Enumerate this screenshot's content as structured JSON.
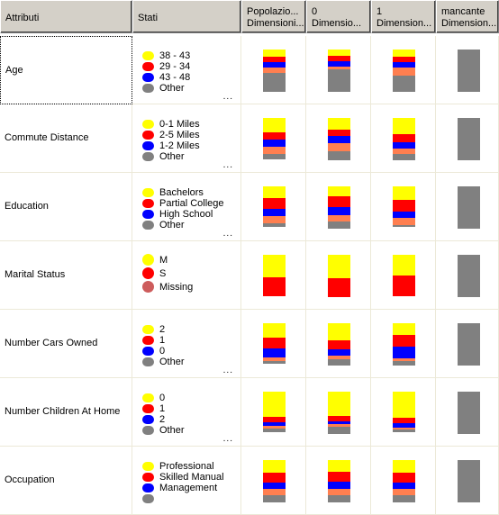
{
  "columns": {
    "attributes": "Attributi",
    "states": "Stati",
    "bars": [
      {
        "line1": "Popolazio...",
        "line2": "Dimensioni..."
      },
      {
        "line1": "0",
        "line2": "Dimensio..."
      },
      {
        "line1": "1",
        "line2": "Dimension..."
      },
      {
        "line1": "mancante",
        "line2": "Dimension..."
      }
    ]
  },
  "colors": {
    "state1": "#ffff00",
    "state2": "#ff0000",
    "state3": "#0000ff",
    "state4": "#ff7f50",
    "other": "#808080",
    "missing": "#cd5c5c"
  },
  "more_label": "...",
  "rows": [
    {
      "attribute": "Age",
      "selected": true,
      "legend": [
        {
          "label": "38 - 43",
          "color": "#ffff00"
        },
        {
          "label": "29 - 34",
          "color": "#ff0000"
        },
        {
          "label": "43 - 48",
          "color": "#0000ff"
        },
        {
          "label": "Other",
          "color": "#808080"
        }
      ],
      "more": true,
      "bars": [
        [
          {
            "c": "#ffff00",
            "v": 0.17
          },
          {
            "c": "#ff0000",
            "v": 0.13
          },
          {
            "c": "#0000ff",
            "v": 0.12
          },
          {
            "c": "#ff7f50",
            "v": 0.13
          },
          {
            "c": "#808080",
            "v": 0.45
          }
        ],
        [
          {
            "c": "#ffff00",
            "v": 0.15
          },
          {
            "c": "#ff0000",
            "v": 0.13
          },
          {
            "c": "#0000ff",
            "v": 0.13
          },
          {
            "c": "#ff7f50",
            "v": 0.06
          },
          {
            "c": "#808080",
            "v": 0.53
          }
        ],
        [
          {
            "c": "#ffff00",
            "v": 0.17
          },
          {
            "c": "#ff0000",
            "v": 0.13
          },
          {
            "c": "#0000ff",
            "v": 0.13
          },
          {
            "c": "#ff7f50",
            "v": 0.19
          },
          {
            "c": "#808080",
            "v": 0.38
          }
        ],
        [
          {
            "c": "#808080",
            "v": 1.0
          }
        ]
      ]
    },
    {
      "attribute": "Commute Distance",
      "legend": [
        {
          "label": "0-1 Miles",
          "color": "#ffff00"
        },
        {
          "label": "2-5 Miles",
          "color": "#ff0000"
        },
        {
          "label": "1-2 Miles",
          "color": "#0000ff"
        },
        {
          "label": "Other",
          "color": "#808080"
        }
      ],
      "more": true,
      "bars": [
        [
          {
            "c": "#ffff00",
            "v": 0.34
          },
          {
            "c": "#ff0000",
            "v": 0.17
          },
          {
            "c": "#0000ff",
            "v": 0.17
          },
          {
            "c": "#ff7f50",
            "v": 0.17
          },
          {
            "c": "#808080",
            "v": 0.13
          }
        ],
        [
          {
            "c": "#ffff00",
            "v": 0.28
          },
          {
            "c": "#ff0000",
            "v": 0.15
          },
          {
            "c": "#0000ff",
            "v": 0.17
          },
          {
            "c": "#ff7f50",
            "v": 0.19
          },
          {
            "c": "#808080",
            "v": 0.21
          }
        ],
        [
          {
            "c": "#ffff00",
            "v": 0.38
          },
          {
            "c": "#ff0000",
            "v": 0.19
          },
          {
            "c": "#0000ff",
            "v": 0.15
          },
          {
            "c": "#ff7f50",
            "v": 0.13
          },
          {
            "c": "#808080",
            "v": 0.15
          }
        ],
        [
          {
            "c": "#808080",
            "v": 1.0
          }
        ]
      ]
    },
    {
      "attribute": "Education",
      "legend": [
        {
          "label": "Bachelors",
          "color": "#ffff00"
        },
        {
          "label": "Partial College",
          "color": "#ff0000"
        },
        {
          "label": "High School",
          "color": "#0000ff"
        },
        {
          "label": "Other",
          "color": "#808080"
        }
      ],
      "more": true,
      "bars": [
        [
          {
            "c": "#ffff00",
            "v": 0.28
          },
          {
            "c": "#ff0000",
            "v": 0.25
          },
          {
            "c": "#0000ff",
            "v": 0.17
          },
          {
            "c": "#ff7f50",
            "v": 0.17
          },
          {
            "c": "#808080",
            "v": 0.09
          }
        ],
        [
          {
            "c": "#ffff00",
            "v": 0.23
          },
          {
            "c": "#ff0000",
            "v": 0.26
          },
          {
            "c": "#0000ff",
            "v": 0.19
          },
          {
            "c": "#ff7f50",
            "v": 0.15
          },
          {
            "c": "#808080",
            "v": 0.17
          }
        ],
        [
          {
            "c": "#ffff00",
            "v": 0.32
          },
          {
            "c": "#ff0000",
            "v": 0.28
          },
          {
            "c": "#0000ff",
            "v": 0.15
          },
          {
            "c": "#ff7f50",
            "v": 0.17
          },
          {
            "c": "#808080",
            "v": 0.04
          }
        ],
        [
          {
            "c": "#808080",
            "v": 1.0
          }
        ]
      ]
    },
    {
      "attribute": "Marital Status",
      "legend": [
        {
          "label": "M",
          "color": "#ffff00"
        },
        {
          "label": "S",
          "color": "#ff0000"
        },
        {
          "label": "Missing",
          "color": "#cd5c5c"
        }
      ],
      "more": false,
      "bars": [
        [
          {
            "c": "#ffff00",
            "v": 0.53
          },
          {
            "c": "#ff0000",
            "v": 0.45
          }
        ],
        [
          {
            "c": "#ffff00",
            "v": 0.55
          },
          {
            "c": "#ff0000",
            "v": 0.45
          }
        ],
        [
          {
            "c": "#ffff00",
            "v": 0.49
          },
          {
            "c": "#ff0000",
            "v": 0.49
          }
        ],
        [
          {
            "c": "#808080",
            "v": 1.0
          }
        ]
      ]
    },
    {
      "attribute": "Number Cars Owned",
      "legend": [
        {
          "label": "2",
          "color": "#ffff00"
        },
        {
          "label": "1",
          "color": "#ff0000"
        },
        {
          "label": "0",
          "color": "#0000ff"
        },
        {
          "label": "Other",
          "color": "#808080"
        }
      ],
      "more": true,
      "bars": [
        [
          {
            "c": "#ffff00",
            "v": 0.34
          },
          {
            "c": "#ff0000",
            "v": 0.26
          },
          {
            "c": "#0000ff",
            "v": 0.21
          },
          {
            "c": "#ff7f50",
            "v": 0.08
          },
          {
            "c": "#808080",
            "v": 0.06
          }
        ],
        [
          {
            "c": "#ffff00",
            "v": 0.4
          },
          {
            "c": "#ff0000",
            "v": 0.21
          },
          {
            "c": "#0000ff",
            "v": 0.15
          },
          {
            "c": "#ff7f50",
            "v": 0.09
          },
          {
            "c": "#808080",
            "v": 0.15
          }
        ],
        [
          {
            "c": "#ffff00",
            "v": 0.28
          },
          {
            "c": "#ff0000",
            "v": 0.28
          },
          {
            "c": "#0000ff",
            "v": 0.28
          },
          {
            "c": "#ff7f50",
            "v": 0.06
          },
          {
            "c": "#808080",
            "v": 0.11
          }
        ],
        [
          {
            "c": "#808080",
            "v": 1.0
          }
        ]
      ]
    },
    {
      "attribute": "Number Children At Home",
      "legend": [
        {
          "label": "0",
          "color": "#ffff00"
        },
        {
          "label": "1",
          "color": "#ff0000"
        },
        {
          "label": "2",
          "color": "#0000ff"
        },
        {
          "label": "Other",
          "color": "#808080"
        }
      ],
      "more": true,
      "bars": [
        [
          {
            "c": "#ffff00",
            "v": 0.6
          },
          {
            "c": "#ff0000",
            "v": 0.13
          },
          {
            "c": "#0000ff",
            "v": 0.09
          },
          {
            "c": "#ff7f50",
            "v": 0.06
          },
          {
            "c": "#808080",
            "v": 0.08
          }
        ],
        [
          {
            "c": "#ffff00",
            "v": 0.57
          },
          {
            "c": "#ff0000",
            "v": 0.13
          },
          {
            "c": "#0000ff",
            "v": 0.06
          },
          {
            "c": "#ff7f50",
            "v": 0.06
          },
          {
            "c": "#808080",
            "v": 0.17
          }
        ],
        [
          {
            "c": "#ffff00",
            "v": 0.62
          },
          {
            "c": "#ff0000",
            "v": 0.13
          },
          {
            "c": "#0000ff",
            "v": 0.11
          },
          {
            "c": "#ff7f50",
            "v": 0.04
          },
          {
            "c": "#808080",
            "v": 0.06
          }
        ],
        [
          {
            "c": "#808080",
            "v": 1.0
          }
        ]
      ]
    },
    {
      "attribute": "Occupation",
      "legend": [
        {
          "label": "Professional",
          "color": "#ffff00"
        },
        {
          "label": "Skilled Manual",
          "color": "#ff0000"
        },
        {
          "label": "Management",
          "color": "#0000ff"
        },
        {
          "label": "",
          "color": "#808080"
        }
      ],
      "more": false,
      "bars": [
        [
          {
            "c": "#ffff00",
            "v": 0.3
          },
          {
            "c": "#ff0000",
            "v": 0.23
          },
          {
            "c": "#0000ff",
            "v": 0.15
          },
          {
            "c": "#ff7f50",
            "v": 0.15
          },
          {
            "c": "#808080",
            "v": 0.17
          }
        ],
        [
          {
            "c": "#ffff00",
            "v": 0.28
          },
          {
            "c": "#ff0000",
            "v": 0.23
          },
          {
            "c": "#0000ff",
            "v": 0.17
          },
          {
            "c": "#ff7f50",
            "v": 0.15
          },
          {
            "c": "#808080",
            "v": 0.17
          }
        ],
        [
          {
            "c": "#ffff00",
            "v": 0.3
          },
          {
            "c": "#ff0000",
            "v": 0.23
          },
          {
            "c": "#0000ff",
            "v": 0.15
          },
          {
            "c": "#ff7f50",
            "v": 0.15
          },
          {
            "c": "#808080",
            "v": 0.17
          }
        ],
        [
          {
            "c": "#808080",
            "v": 1.0
          }
        ]
      ]
    }
  ]
}
